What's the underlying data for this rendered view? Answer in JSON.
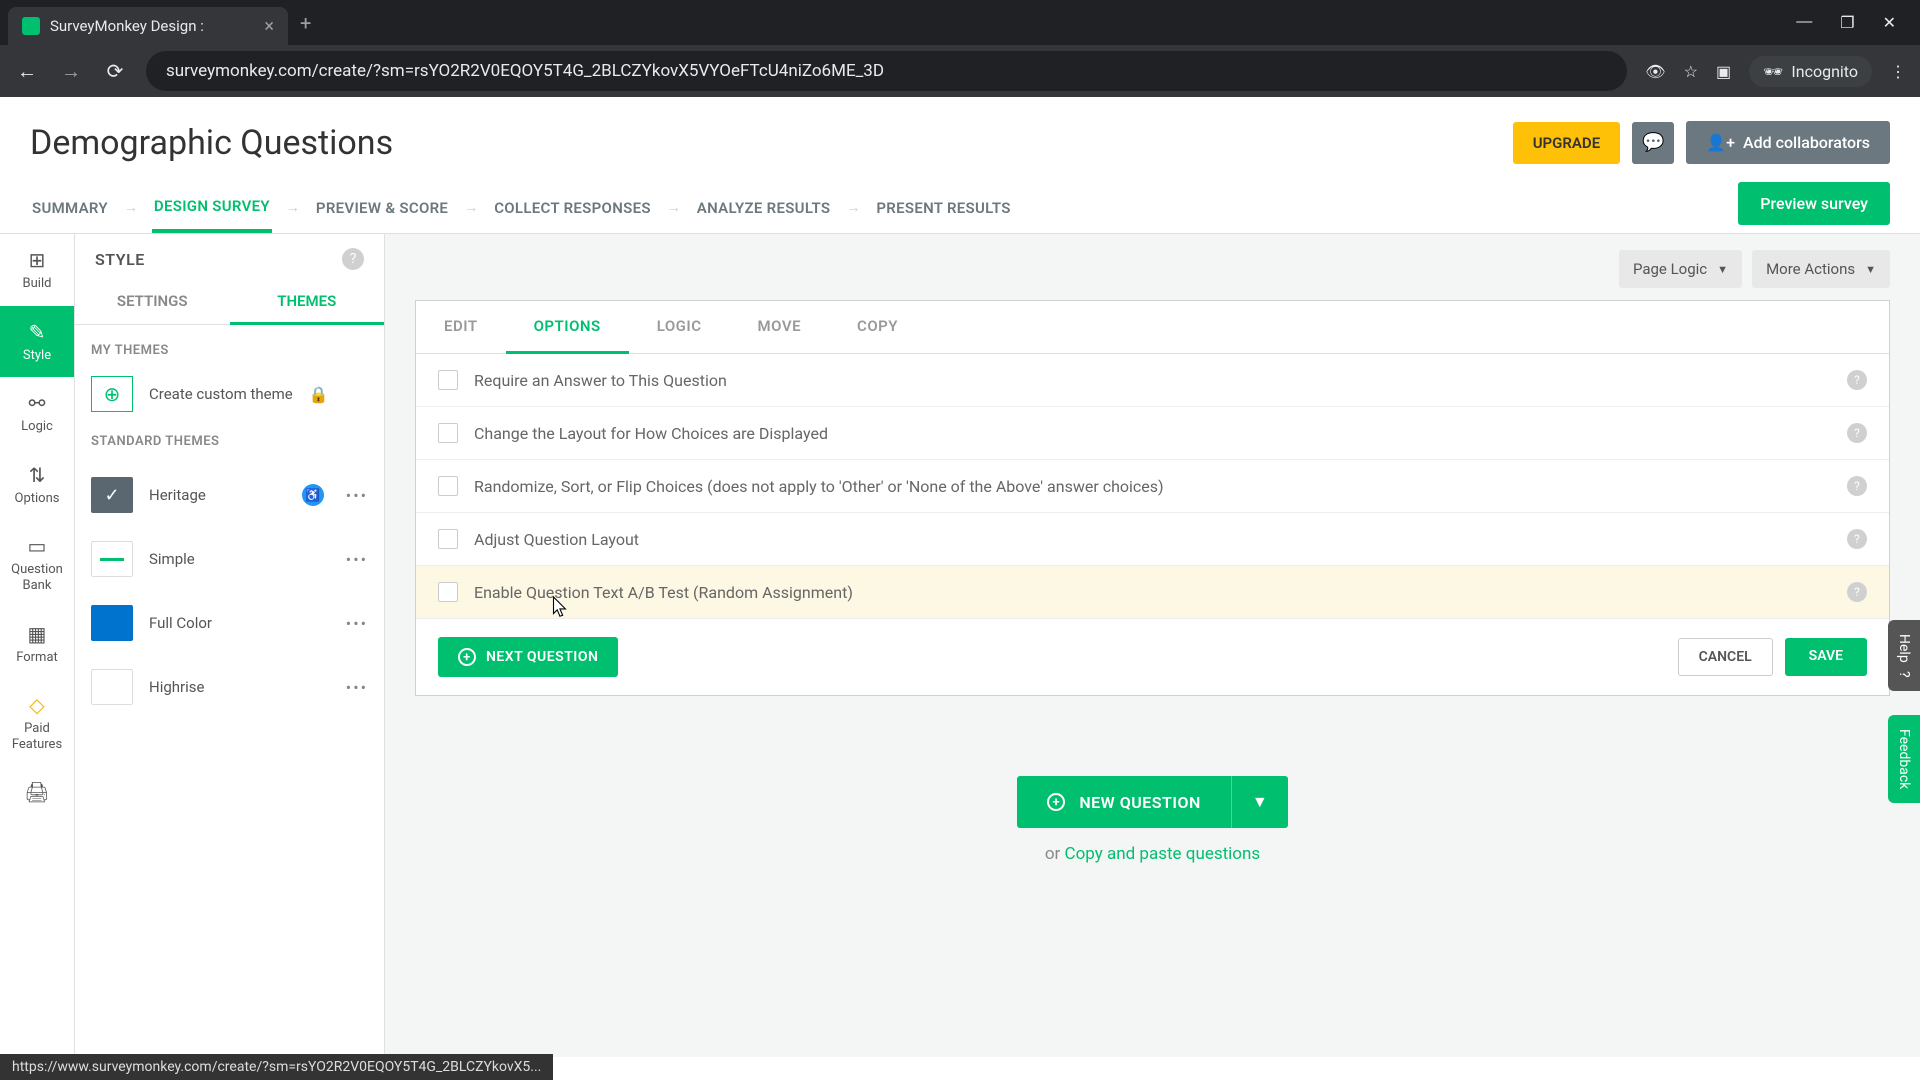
{
  "browser": {
    "tab_title": "SurveyMonkey Design :",
    "url": "surveymonkey.com/create/?sm=rsYO2R2V0EQOY5T4G_2BLCZYkovX5VYOeFTcU4niZo6ME_3D",
    "incognito_label": "Incognito"
  },
  "header": {
    "title": "Demographic Questions",
    "upgrade": "UPGRADE",
    "add_collab": "Add collaborators"
  },
  "nav": {
    "tabs": [
      "SUMMARY",
      "DESIGN SURVEY",
      "PREVIEW & SCORE",
      "COLLECT RESPONSES",
      "ANALYZE RESULTS",
      "PRESENT RESULTS"
    ],
    "preview": "Preview survey"
  },
  "rail": {
    "items": [
      "Build",
      "Style",
      "Logic",
      "Options",
      "Question Bank",
      "Format",
      "Paid Features"
    ]
  },
  "panel": {
    "title": "STYLE",
    "tabs": [
      "SETTINGS",
      "THEMES"
    ],
    "my_themes": "MY THEMES",
    "create_theme": "Create custom theme",
    "standard_themes": "STANDARD THEMES",
    "themes": [
      "Heritage",
      "Simple",
      "Full Color",
      "Highrise"
    ]
  },
  "canvas": {
    "page_logic": "Page Logic",
    "more_actions": "More Actions",
    "q_tabs": [
      "EDIT",
      "OPTIONS",
      "LOGIC",
      "MOVE",
      "COPY"
    ],
    "options": [
      "Require an Answer to This Question",
      "Change the Layout for How Choices are Displayed",
      "Randomize, Sort, or Flip Choices (does not apply to 'Other' or 'None of the Above' answer choices)",
      "Adjust Question Layout",
      "Enable Question Text A/B Test (Random Assignment)"
    ],
    "next_q": "NEXT QUESTION",
    "cancel": "CANCEL",
    "save": "SAVE",
    "new_q": "NEW QUESTION",
    "copy_paste_prefix": "or ",
    "copy_paste_link": "Copy and paste questions"
  },
  "sidetabs": {
    "help": "Help",
    "feedback": "Feedback"
  },
  "status_url": "https://www.surveymonkey.com/create/?sm=rsYO2R2V0EQOY5T4G_2BLCZYkovX5..."
}
